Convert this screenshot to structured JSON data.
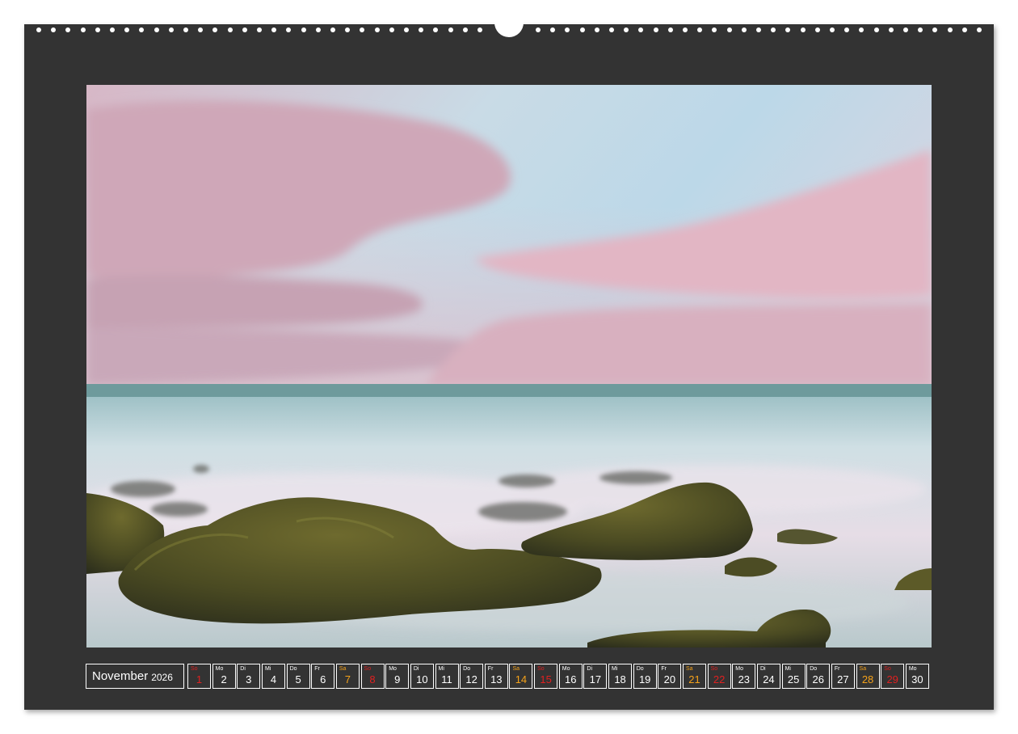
{
  "calendar": {
    "month": "November",
    "year": "2026",
    "days": [
      {
        "abbr": "So",
        "num": "1",
        "type": "sun"
      },
      {
        "abbr": "Mo",
        "num": "2",
        "type": "wd"
      },
      {
        "abbr": "Di",
        "num": "3",
        "type": "wd"
      },
      {
        "abbr": "Mi",
        "num": "4",
        "type": "wd"
      },
      {
        "abbr": "Do",
        "num": "5",
        "type": "wd"
      },
      {
        "abbr": "Fr",
        "num": "6",
        "type": "wd"
      },
      {
        "abbr": "Sa",
        "num": "7",
        "type": "sat"
      },
      {
        "abbr": "So",
        "num": "8",
        "type": "sun"
      },
      {
        "abbr": "Mo",
        "num": "9",
        "type": "wd"
      },
      {
        "abbr": "Di",
        "num": "10",
        "type": "wd"
      },
      {
        "abbr": "Mi",
        "num": "11",
        "type": "wd"
      },
      {
        "abbr": "Do",
        "num": "12",
        "type": "wd"
      },
      {
        "abbr": "Fr",
        "num": "13",
        "type": "wd"
      },
      {
        "abbr": "Sa",
        "num": "14",
        "type": "sat"
      },
      {
        "abbr": "So",
        "num": "15",
        "type": "sun"
      },
      {
        "abbr": "Mo",
        "num": "16",
        "type": "wd"
      },
      {
        "abbr": "Di",
        "num": "17",
        "type": "wd"
      },
      {
        "abbr": "Mi",
        "num": "18",
        "type": "wd"
      },
      {
        "abbr": "Do",
        "num": "19",
        "type": "wd"
      },
      {
        "abbr": "Fr",
        "num": "20",
        "type": "wd"
      },
      {
        "abbr": "Sa",
        "num": "21",
        "type": "sat"
      },
      {
        "abbr": "So",
        "num": "22",
        "type": "sun"
      },
      {
        "abbr": "Mo",
        "num": "23",
        "type": "wd"
      },
      {
        "abbr": "Di",
        "num": "24",
        "type": "wd"
      },
      {
        "abbr": "Mi",
        "num": "25",
        "type": "wd"
      },
      {
        "abbr": "Do",
        "num": "26",
        "type": "wd"
      },
      {
        "abbr": "Fr",
        "num": "27",
        "type": "wd"
      },
      {
        "abbr": "Sa",
        "num": "28",
        "type": "sat"
      },
      {
        "abbr": "So",
        "num": "29",
        "type": "sun"
      },
      {
        "abbr": "Mo",
        "num": "30",
        "type": "wd"
      }
    ]
  },
  "colors": {
    "page_background": "#333333",
    "saturday": "#f5a21a",
    "sunday": "#e02020",
    "weekday": "#ffffff"
  }
}
